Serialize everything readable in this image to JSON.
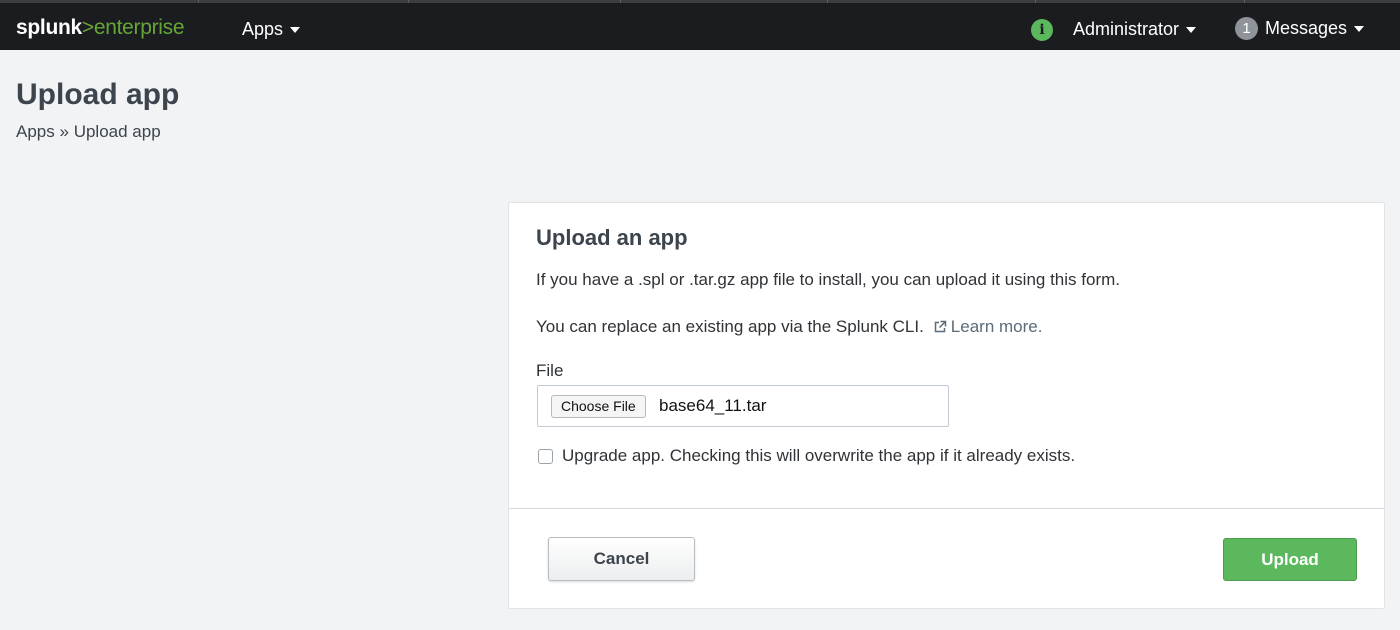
{
  "topbar": {
    "logo_part1": "splunk",
    "logo_part2": ">",
    "logo_part3": "enterprise",
    "apps_label": "Apps",
    "info_icon_glyph": "i",
    "user_label": "Administrator",
    "messages_count": "1",
    "messages_label": "Messages"
  },
  "page": {
    "title": "Upload app",
    "breadcrumb_link": "Apps",
    "breadcrumb_separator": "»",
    "breadcrumb_current": "Upload app"
  },
  "form": {
    "title": "Upload an app",
    "description": "If you have a .spl or .tar.gz app file to install, you can upload it using this form.",
    "replace_text": "You can replace an existing app via the Splunk CLI.",
    "learn_more": "Learn more.",
    "file_label": "File",
    "choose_file_label": "Choose File",
    "file_name": "base64_11.tar",
    "upgrade_label": "Upgrade app. Checking this will overwrite the app if it already exists.",
    "upgrade_checked": false,
    "cancel_label": "Cancel",
    "upload_label": "Upload"
  },
  "colors": {
    "topbar_bg": "#1a1c20",
    "brand_green": "#65a637",
    "upload_button": "#5cb85c",
    "page_bg": "#f2f3f5"
  },
  "icons": {
    "info": "info-icon",
    "caret": "caret-down-icon",
    "external_link": "external-link-icon"
  }
}
